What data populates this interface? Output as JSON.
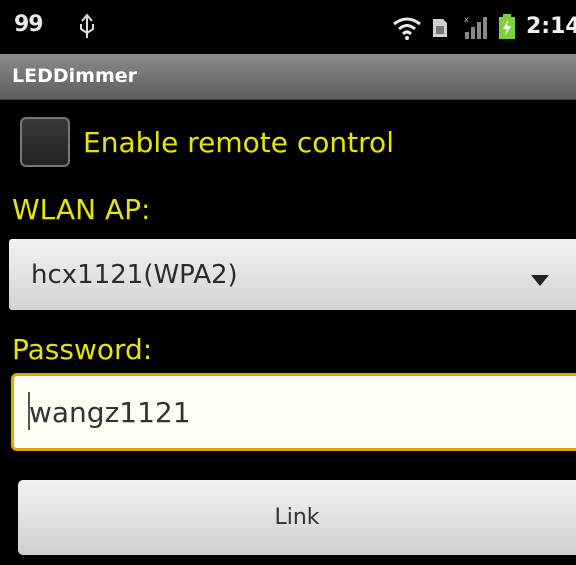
{
  "status_bar": {
    "badge": "99",
    "time": "2:14"
  },
  "app": {
    "title": "LEDDimmer"
  },
  "remote": {
    "checkbox_label": "Enable remote control",
    "checked": false
  },
  "wlan": {
    "label": "WLAN AP:",
    "selected": "hcx1121(WPA2)"
  },
  "password": {
    "label": "Password:",
    "value": "wangz1121"
  },
  "link_button": {
    "label": "Link"
  },
  "colors": {
    "label_text": "#e6e600",
    "focus_border": "#e8a400",
    "background": "#000000"
  },
  "icons": [
    "usb-icon",
    "wifi-icon",
    "sim-icon",
    "signal-icon",
    "battery-icon",
    "dropdown-arrow-icon"
  ]
}
